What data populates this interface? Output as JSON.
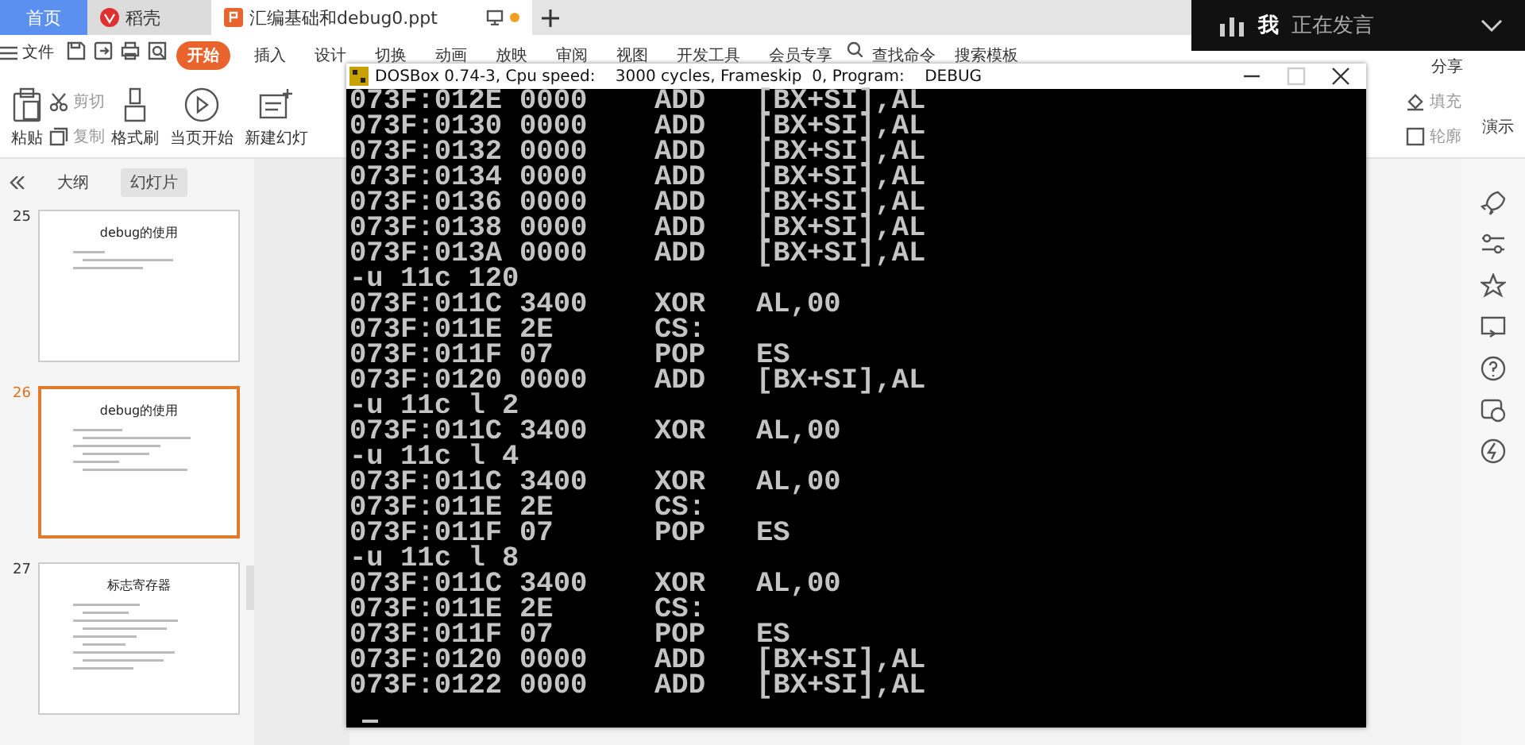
{
  "tabs": [
    {
      "label": "首页",
      "selected": false,
      "kind": "home"
    },
    {
      "label": "稻壳",
      "selected": false,
      "kind": "docer"
    },
    {
      "label": "汇编基础和debug0.ppt",
      "selected": true,
      "kind": "doc"
    }
  ],
  "speaker_overlay": {
    "name": "我",
    "status": "正在发言"
  },
  "menu": {
    "file": "文件",
    "start": "开始",
    "tabs": [
      "插入",
      "设计",
      "切换",
      "动画",
      "放映",
      "审阅",
      "视图",
      "开发工具",
      "会员专享"
    ],
    "search": "查找命令",
    "template_search": "搜索模板",
    "right": [
      "分享"
    ]
  },
  "ribbon": {
    "paste": "粘贴",
    "cut": "剪切",
    "copy": "复制",
    "format_painter": "格式刷",
    "play": "当页开始",
    "new_slide": "新建幻灯",
    "fill": "填充",
    "outline": "轮廓",
    "present": "演示"
  },
  "sidebar": {
    "tabs": [
      {
        "label": "大纲",
        "selected": false
      },
      {
        "label": "幻灯片",
        "selected": true
      }
    ],
    "slides": [
      {
        "number": "25",
        "title": "debug的使用",
        "selected": false
      },
      {
        "number": "26",
        "title": "debug的使用",
        "selected": true
      },
      {
        "number": "27",
        "title": "标志寄存器",
        "selected": false
      }
    ]
  },
  "dosbox": {
    "title": "DOSBox 0.74-3, Cpu speed:    3000 cycles, Frameskip  0, Program:    DEBUG",
    "lines": [
      {
        "kind": "asm",
        "address": "073F:012E",
        "bytes": "0000",
        "mnemonic": "ADD",
        "operands": "[BX+SI],AL"
      },
      {
        "kind": "asm",
        "address": "073F:0130",
        "bytes": "0000",
        "mnemonic": "ADD",
        "operands": "[BX+SI],AL"
      },
      {
        "kind": "asm",
        "address": "073F:0132",
        "bytes": "0000",
        "mnemonic": "ADD",
        "operands": "[BX+SI],AL"
      },
      {
        "kind": "asm",
        "address": "073F:0134",
        "bytes": "0000",
        "mnemonic": "ADD",
        "operands": "[BX+SI],AL"
      },
      {
        "kind": "asm",
        "address": "073F:0136",
        "bytes": "0000",
        "mnemonic": "ADD",
        "operands": "[BX+SI],AL"
      },
      {
        "kind": "asm",
        "address": "073F:0138",
        "bytes": "0000",
        "mnemonic": "ADD",
        "operands": "[BX+SI],AL"
      },
      {
        "kind": "asm",
        "address": "073F:013A",
        "bytes": "0000",
        "mnemonic": "ADD",
        "operands": "[BX+SI],AL"
      },
      {
        "kind": "command",
        "text": "-u 11c 120"
      },
      {
        "kind": "asm",
        "address": "073F:011C",
        "bytes": "3400",
        "mnemonic": "XOR",
        "operands": "AL,00"
      },
      {
        "kind": "asm",
        "address": "073F:011E",
        "bytes": "2E",
        "mnemonic": "CS:"
      },
      {
        "kind": "asm",
        "address": "073F:011F",
        "bytes": "07",
        "mnemonic": "POP",
        "operands": "ES"
      },
      {
        "kind": "asm",
        "address": "073F:0120",
        "bytes": "0000",
        "mnemonic": "ADD",
        "operands": "[BX+SI],AL"
      },
      {
        "kind": "command",
        "text": "-u 11c l 2"
      },
      {
        "kind": "asm",
        "address": "073F:011C",
        "bytes": "3400",
        "mnemonic": "XOR",
        "operands": "AL,00"
      },
      {
        "kind": "command",
        "text": "-u 11c l 4"
      },
      {
        "kind": "asm",
        "address": "073F:011C",
        "bytes": "3400",
        "mnemonic": "XOR",
        "operands": "AL,00"
      },
      {
        "kind": "asm",
        "address": "073F:011E",
        "bytes": "2E",
        "mnemonic": "CS:"
      },
      {
        "kind": "asm",
        "address": "073F:011F",
        "bytes": "07",
        "mnemonic": "POP",
        "operands": "ES"
      },
      {
        "kind": "command",
        "text": "-u 11c l 8"
      },
      {
        "kind": "asm",
        "address": "073F:011C",
        "bytes": "3400",
        "mnemonic": "XOR",
        "operands": "AL,00"
      },
      {
        "kind": "asm",
        "address": "073F:011E",
        "bytes": "2E",
        "mnemonic": "CS:"
      },
      {
        "kind": "asm",
        "address": "073F:011F",
        "bytes": "07",
        "mnemonic": "POP",
        "operands": "ES"
      },
      {
        "kind": "asm",
        "address": "073F:0120",
        "bytes": "0000",
        "mnemonic": "ADD",
        "operands": "[BX+SI],AL"
      },
      {
        "kind": "asm",
        "address": "073F:0122",
        "bytes": "0000",
        "mnemonic": "ADD",
        "operands": "[BX+SI],AL"
      },
      {
        "kind": "cursor"
      }
    ]
  }
}
